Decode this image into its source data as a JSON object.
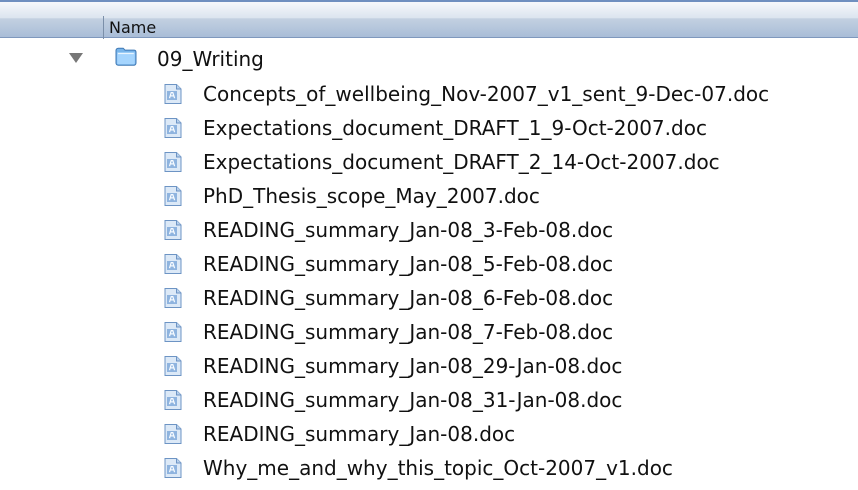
{
  "header": {
    "name_label": "Name"
  },
  "folder": {
    "name": "09_Writing",
    "expanded": true,
    "icon": "folder-icon",
    "disclosure_icon": "disclosure-triangle-expanded-icon"
  },
  "files": [
    {
      "name": "Concepts_of_wellbeing_Nov-2007_v1_sent_9-Dec-07.doc",
      "icon": "word-document-icon"
    },
    {
      "name": "Expectations_document_DRAFT_1_9-Oct-2007.doc",
      "icon": "word-document-icon"
    },
    {
      "name": "Expectations_document_DRAFT_2_14-Oct-2007.doc",
      "icon": "word-document-icon"
    },
    {
      "name": "PhD_Thesis_scope_May_2007.doc",
      "icon": "word-document-icon"
    },
    {
      "name": "READING_summary_Jan-08_3-Feb-08.doc",
      "icon": "word-document-icon"
    },
    {
      "name": "READING_summary_Jan-08_5-Feb-08.doc",
      "icon": "word-document-icon"
    },
    {
      "name": "READING_summary_Jan-08_6-Feb-08.doc",
      "icon": "word-document-icon"
    },
    {
      "name": "READING_summary_Jan-08_7-Feb-08.doc",
      "icon": "word-document-icon"
    },
    {
      "name": "READING_summary_Jan-08_29-Jan-08.doc",
      "icon": "word-document-icon"
    },
    {
      "name": "READING_summary_Jan-08_31-Jan-08.doc",
      "icon": "word-document-icon"
    },
    {
      "name": "READING_summary_Jan-08.doc",
      "icon": "word-document-icon"
    },
    {
      "name": "Why_me_and_why_this_topic_Oct-2007_v1.doc",
      "icon": "word-document-icon"
    }
  ],
  "colors": {
    "header_gradient_top": "#f6f8fb",
    "header_gradient_bottom": "#a9bdd7",
    "folder_blue": "#78b5ea",
    "document_blue": "#8fb4df",
    "text": "#111111"
  }
}
